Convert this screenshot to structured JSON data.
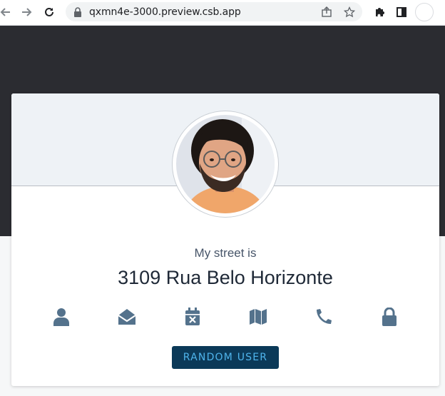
{
  "browser": {
    "url": "qxmn4e-3000.preview.csb.app",
    "icons": [
      "back-arrow-icon",
      "forward-arrow-icon",
      "reload-icon",
      "lock-icon",
      "share-icon",
      "bookmark-star-icon",
      "extensions-puzzle-icon",
      "side-panel-icon",
      "profile-icon"
    ]
  },
  "card": {
    "label": "My street is",
    "value": "3109 Rua Belo Horizonte",
    "icons": [
      "user-icon",
      "envelope-open-icon",
      "calendar-x-icon",
      "map-icon",
      "phone-icon",
      "lock-icon"
    ],
    "button_label": "RANDOM USER"
  },
  "colors": {
    "dark_band": "#2b2c31",
    "header_bg": "#eef2f6",
    "icon": "#54728c",
    "button_bg": "#0b3958",
    "button_text": "#4fb4ec"
  }
}
